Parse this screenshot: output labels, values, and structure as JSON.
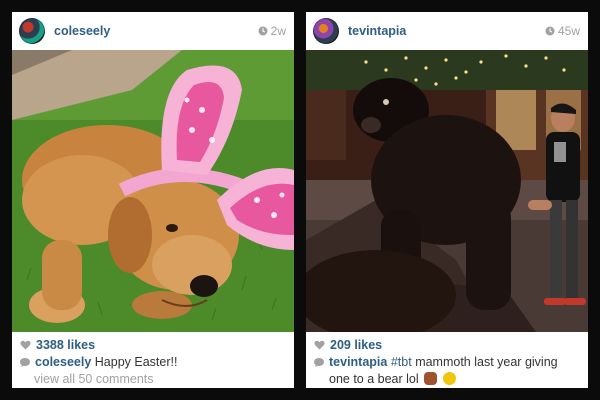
{
  "posts": [
    {
      "username": "coleseely",
      "time": "2w",
      "likes": "3388 likes",
      "caption": {
        "user": "coleseely",
        "text": "Happy Easter!!"
      },
      "view_comments": "view all 50 comments",
      "photo_subject": "dog-with-bunny-ears"
    },
    {
      "username": "tevintapia",
      "time": "45w",
      "likes": "209 likes",
      "caption": {
        "user": "tevintapia",
        "hashtag": "#tbt",
        "text": "mammoth last year giving one to a bear lol",
        "emojis": [
          "bear-emoji",
          "laughing-emoji"
        ]
      },
      "photo_subject": "person-with-bear-statue"
    }
  ],
  "colors": {
    "link_blue": "#2e5e86",
    "muted_gray": "#a1a1a1",
    "background": "#0b0b0b"
  }
}
